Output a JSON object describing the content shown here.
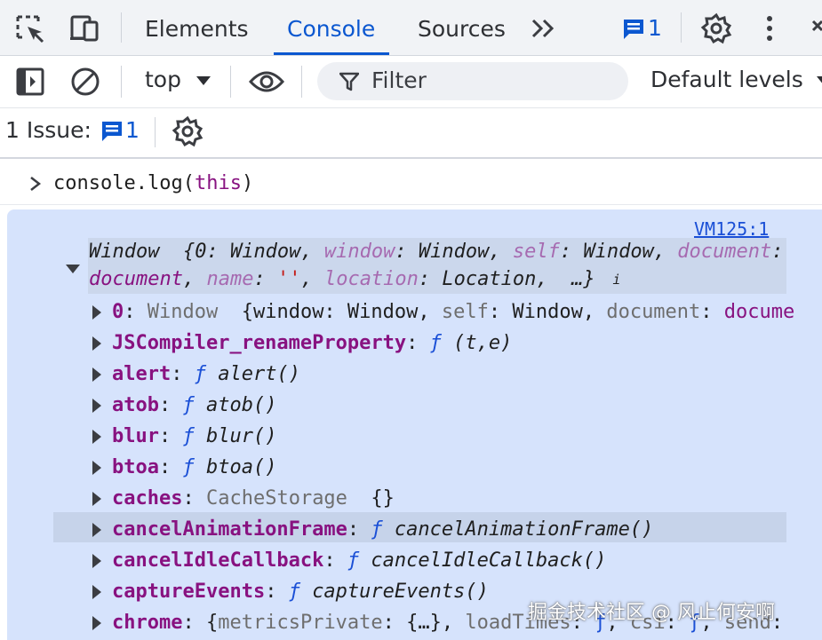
{
  "tabbar": {
    "tabs": [
      {
        "label": "Elements",
        "active": false
      },
      {
        "label": "Console",
        "active": true
      },
      {
        "label": "Sources",
        "active": false
      }
    ],
    "more_glyph": "»",
    "issues_count": "1",
    "accent": "#0b57d0"
  },
  "toolbar": {
    "context": "top",
    "filter_placeholder": "Filter",
    "levels": "Default levels"
  },
  "issues": {
    "label": "1 Issue:",
    "count": "1"
  },
  "console": {
    "command": {
      "prefix": "console.log(",
      "keyword": "this",
      "suffix": ")"
    },
    "source_link": "VM125:1",
    "summary": {
      "line1": [
        {
          "t": "Window  ",
          "c": "v"
        },
        {
          "t": "{0: Window, ",
          "c": "v"
        },
        {
          "t": "window",
          "c": "kd"
        },
        {
          "t": ": Window, ",
          "c": "v"
        },
        {
          "t": "self",
          "c": "kd"
        },
        {
          "t": ": Window, ",
          "c": "v"
        },
        {
          "t": "document",
          "c": "kd"
        },
        {
          "t": ":",
          "c": "v"
        }
      ],
      "line2": [
        {
          "t": "document",
          "c": "k"
        },
        {
          "t": ", ",
          "c": "v"
        },
        {
          "t": "name",
          "c": "kd"
        },
        {
          "t": ": ",
          "c": "v"
        },
        {
          "t": "''",
          "c": "str"
        },
        {
          "t": ", ",
          "c": "v"
        },
        {
          "t": "location",
          "c": "kd"
        },
        {
          "t": ": Location,  ",
          "c": "v"
        },
        {
          "t": "…}",
          "c": "v"
        }
      ],
      "info": "i"
    },
    "properties": [
      {
        "key": "0",
        "sep": ": ",
        "value": [
          {
            "t": "Window  ",
            "c": "g"
          },
          {
            "t": "{window: Window, ",
            "c": "v"
          },
          {
            "t": "self",
            "c": "g"
          },
          {
            "t": ": Window, ",
            "c": "v"
          },
          {
            "t": "document",
            "c": "g"
          },
          {
            "t": ": ",
            "c": "v"
          },
          {
            "t": "docume",
            "c": "k"
          }
        ],
        "fn": false
      },
      {
        "key": "JSCompiler_renameProperty",
        "sep": ": ",
        "fn": true,
        "fname": "(t,e)"
      },
      {
        "key": "alert",
        "sep": ": ",
        "fn": true,
        "fname": "alert()"
      },
      {
        "key": "atob",
        "sep": ": ",
        "fn": true,
        "fname": "atob()"
      },
      {
        "key": "blur",
        "sep": ": ",
        "fn": true,
        "fname": "blur()"
      },
      {
        "key": "btoa",
        "sep": ": ",
        "fn": true,
        "fname": "btoa()"
      },
      {
        "key": "caches",
        "sep": ": ",
        "value": [
          {
            "t": "CacheStorage  ",
            "c": "g"
          },
          {
            "t": "{}",
            "c": "v"
          }
        ],
        "fn": false
      },
      {
        "key": "cancelAnimationFrame",
        "sep": ": ",
        "fn": true,
        "fname": "cancelAnimationFrame()",
        "highlight": true
      },
      {
        "key": "cancelIdleCallback",
        "sep": ": ",
        "fn": true,
        "fname": "cancelIdleCallback()"
      },
      {
        "key": "captureEvents",
        "sep": ": ",
        "fn": true,
        "fname": "captureEvents()"
      },
      {
        "key": "chrome",
        "sep": ": ",
        "value": [
          {
            "t": "{",
            "c": "v"
          },
          {
            "t": "metricsPrivate",
            "c": "g"
          },
          {
            "t": ": {…}, ",
            "c": "v"
          },
          {
            "t": "loadTimes",
            "c": "g"
          },
          {
            "t": ": ",
            "c": "v"
          },
          {
            "t": "ƒ",
            "c": "f"
          },
          {
            "t": ", ",
            "c": "v"
          },
          {
            "t": "csi",
            "c": "g"
          },
          {
            "t": ": ",
            "c": "v"
          },
          {
            "t": "ƒ",
            "c": "f"
          },
          {
            "t": ", ",
            "c": "v"
          },
          {
            "t": "send",
            "c": "g"
          },
          {
            "t": ":",
            "c": "v"
          }
        ],
        "fn": false
      }
    ],
    "fn_glyph": "ƒ"
  },
  "watermark": "掘金技术社区 @ 风止何安啊"
}
